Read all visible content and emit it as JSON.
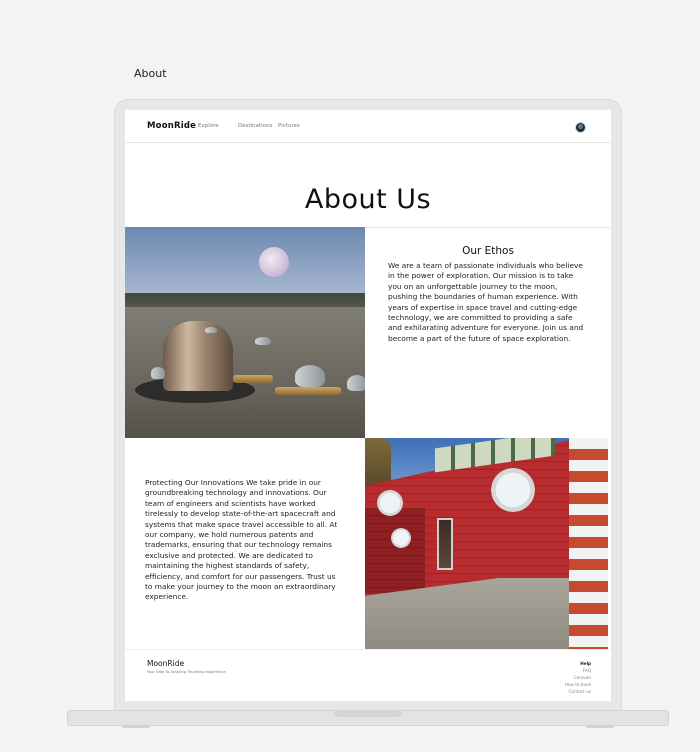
{
  "frame": {
    "label": "About"
  },
  "nav": {
    "brand": "MoonRide",
    "links": [
      "Explore",
      "Destinations",
      "Pictures"
    ]
  },
  "page": {
    "title": "About Us"
  },
  "ethos": {
    "title": "Our Ethos",
    "body": "We are a team of passionate individuals who believe in the power of exploration. Our mission is to take you on an unforgettable journey to the moon, pushing the boundaries of human experience. With years of expertise in space travel and cutting-edge technology, we are committed to providing a safe and exhilarating adventure for everyone. Join us and become a part of the future of space exploration."
  },
  "innovations": {
    "body": "Protecting Our Innovations We take pride in our groundbreaking technology and innovations. Our team of engineers and scientists have worked tirelessly to develop state-of-the-art spacecraft and systems that make space travel accessible to all. At our company, we hold numerous patents and trademarks, ensuring that our technology remains exclusive and protected. We are dedicated to maintaining the highest standards of safety, efficiency, and comfort for our passengers. Trust us to make your journey to the moon an extraordinary experience."
  },
  "footer": {
    "brand": "MoonRide",
    "tagline": "Your Gate To Amazing Travelling experience",
    "links": [
      "Help",
      "FAQ",
      "Caravan",
      "How to book",
      "Contact us"
    ]
  }
}
